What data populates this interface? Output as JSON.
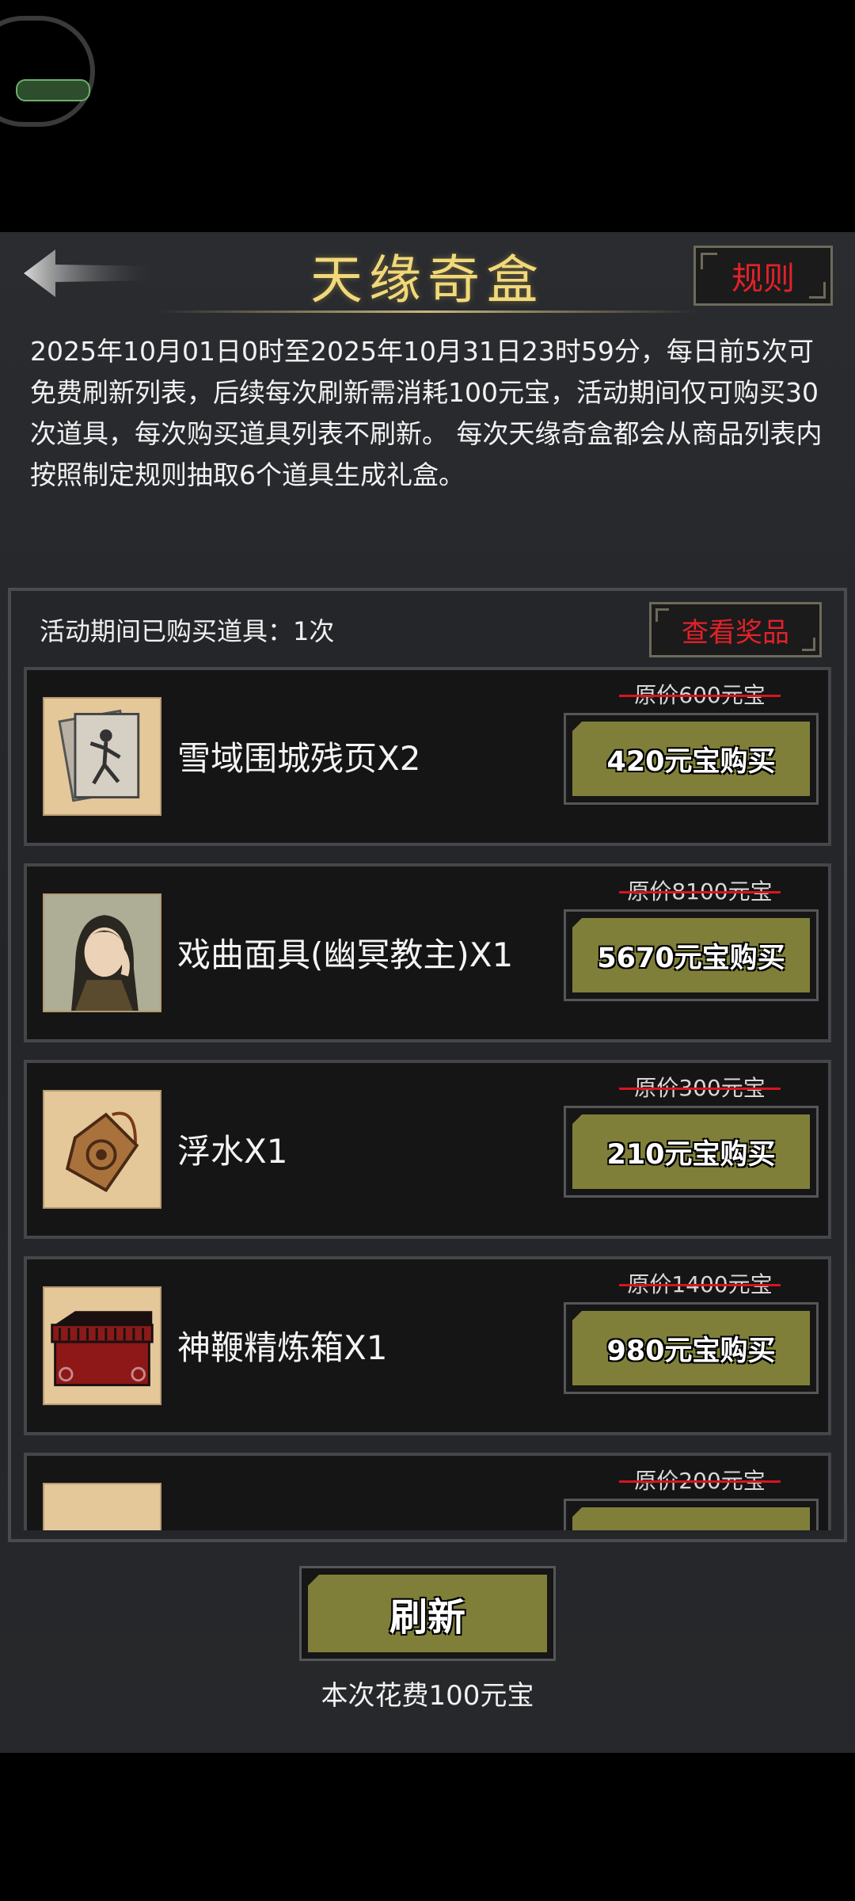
{
  "header": {
    "title": "天缘奇盒",
    "rules_label": "规则"
  },
  "description": "2025年10月01日0时至2025年10月31日23时59分，每日前5次可免费刷新列表，后续每次刷新需消耗100元宝，活动期间仅可购买30次道具，每次购买道具列表不刷新。 每次天缘奇盒都会从商品列表内按照制定规则抽取6个道具生成礼盒。",
  "list": {
    "purchased_text": "活动期间已购买道具：1次",
    "view_prizes_label": "查看奖品",
    "items": [
      {
        "name": "雪域围城残页X2",
        "original_price": "原价600元宝",
        "buy_label": "420元宝购买",
        "icon": "scroll-pages-icon",
        "name_color": "#f4f4f4"
      },
      {
        "name": "戏曲面具(幽冥教主)X1",
        "original_price": "原价8100元宝",
        "buy_label": "5670元宝购买",
        "icon": "character-portrait-icon",
        "name_color": "#f4f4f4"
      },
      {
        "name": "浮水X1",
        "original_price": "原价300元宝",
        "buy_label": "210元宝购买",
        "icon": "jade-token-icon",
        "name_color": "#f4f4f4"
      },
      {
        "name": "神鞭精炼箱X1",
        "original_price": "原价1400元宝",
        "buy_label": "980元宝购买",
        "icon": "red-chest-icon",
        "name_color": "#f4f4f4"
      },
      {
        "name": "",
        "original_price": "原价200元宝",
        "buy_label": "",
        "icon": "ore-icon",
        "name_color": "#c0389a"
      }
    ]
  },
  "footer": {
    "refresh_label": "刷新",
    "cost_text": "本次花费100元宝"
  },
  "colors": {
    "title_gold": "#f1d97a",
    "rules_red": "#e3212a",
    "button_olive": "#7f7f3a",
    "strike_red": "#d8151e"
  }
}
